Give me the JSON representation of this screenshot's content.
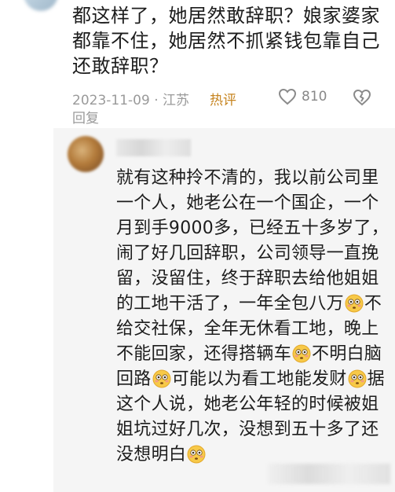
{
  "comment1": {
    "line1": "都这样了，她居然敢辞职？娘家婆家",
    "line2": "都靠不住，她居然不抓紧钱包靠自己",
    "line3": "还敢辞职？",
    "date": "2023-11-09 · 江苏",
    "hot_label": "热评",
    "like_count": "810",
    "reply_label": "回复"
  },
  "reply": {
    "segments": [
      "就有这种拎不清的，我以前公司里一个人，她老公在一个国企，一个月到手9000多，已经五十多岁了，闹了好几回辞职，公司领导一直挽留，没留住，终于辞职去给他姐姐的工地干活了，一年全包八万",
      "不给交社保，全年无休看工地，晚上不能回家，还得搭辆车",
      "不明白脑回路",
      "可能以为看工地能发财",
      "据这个人说，她老公年轻的时候被姐姐坑过好几次，没想到五十多了还没想明白",
      ""
    ]
  },
  "icons": {
    "like": "heart-outline-icon",
    "dislike": "broken-heart-icon",
    "emoji": "flushed-face-emoji"
  }
}
